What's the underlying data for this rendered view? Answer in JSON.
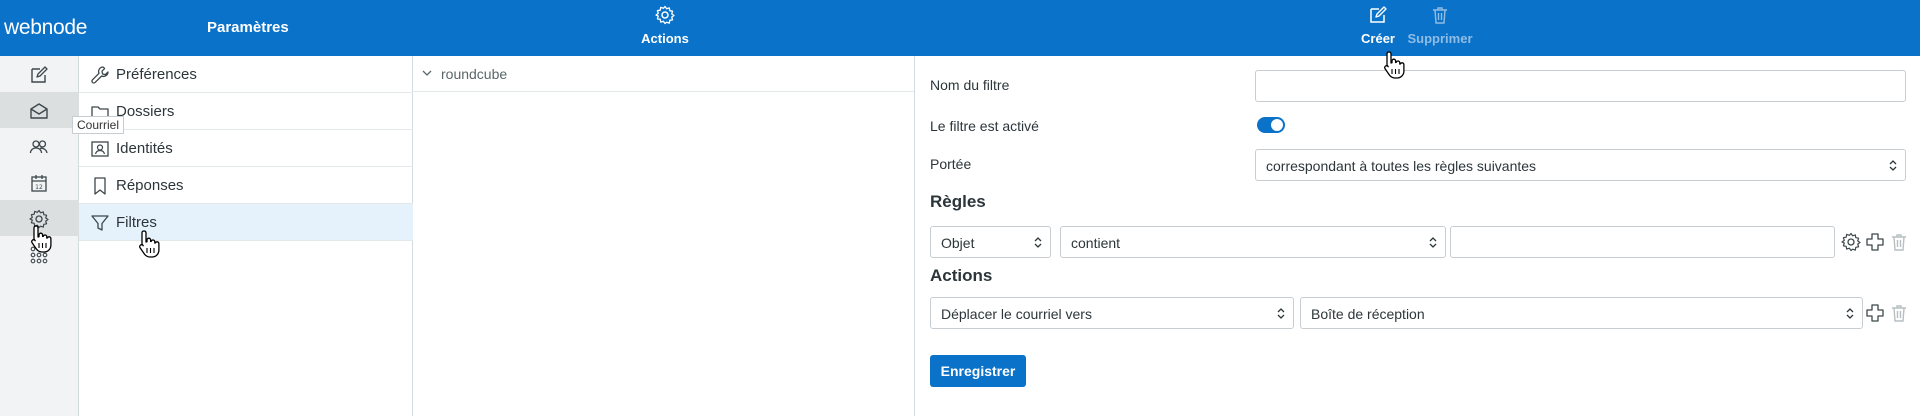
{
  "header": {
    "logo": "webnode",
    "title": "Paramètres",
    "actions_label": "Actions",
    "create_label": "Créer",
    "delete_label": "Supprimer"
  },
  "iconbar": {
    "tooltip": "Courriel",
    "items": [
      "compose-icon",
      "mail-icon",
      "contacts-icon",
      "calendar-icon",
      "settings-icon",
      "apps-icon"
    ]
  },
  "settings": {
    "items": [
      {
        "label": "Préférences",
        "icon": "wrench-icon"
      },
      {
        "label": "Dossiers",
        "icon": "folder-icon"
      },
      {
        "label": "Identités",
        "icon": "identity-icon"
      },
      {
        "label": "Réponses",
        "icon": "bookmark-icon"
      },
      {
        "label": "Filtres",
        "icon": "filter-icon",
        "active": true
      }
    ]
  },
  "filtersets": {
    "name": "roundcube"
  },
  "form": {
    "filter_name_label": "Nom du filtre",
    "filter_name_value": "",
    "enabled_label": "Le filtre est activé",
    "enabled": true,
    "scope_label": "Portée",
    "scope_value": "correspondant à toutes les règles suivantes",
    "rules_title": "Règles",
    "rule_header": "Objet",
    "rule_operator": "contient",
    "rule_value": "",
    "actions_title": "Actions",
    "action_type": "Déplacer le courriel vers",
    "action_target": "Boîte de réception",
    "save_label": "Enregistrer"
  },
  "colors": {
    "brand": "#0a72c9",
    "active_row": "#e5f1fb"
  }
}
